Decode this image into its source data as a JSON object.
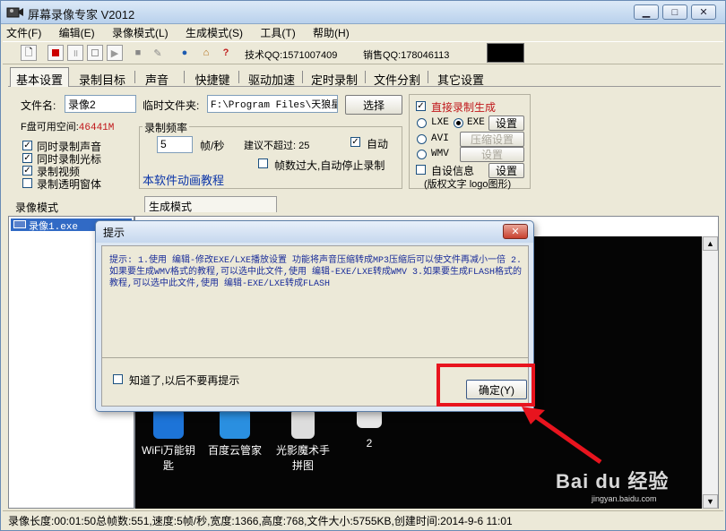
{
  "window": {
    "title": "屏幕录像专家 V2012"
  },
  "menu": [
    "文件(F)",
    "编辑(E)",
    "录像模式(L)",
    "生成模式(S)",
    "工具(T)",
    "帮助(H)"
  ],
  "toolbar": {
    "support_qq": "技术QQ:1571007409",
    "sales_qq": "销售QQ:178046113"
  },
  "tabs": [
    "基本设置",
    "录制目标",
    "声音",
    "快捷键",
    "驱动加速",
    "定时录制",
    "文件分割",
    "其它设置"
  ],
  "basic": {
    "filename_label": "文件名:",
    "filename_value": "录像2",
    "tempdir_label": "临时文件夹:",
    "tempdir_value": "F:\\Program Files\\天狼星",
    "select_button": "选择",
    "disk_label": "F盘可用空间:",
    "disk_value": "46441M",
    "options": [
      {
        "label": "同时录制声音",
        "checked": true
      },
      {
        "label": "同时录制光标",
        "checked": true
      },
      {
        "label": "录制视频",
        "checked": true
      },
      {
        "label": "录制透明窗体",
        "checked": false
      }
    ],
    "freq_group": "录制频率",
    "fps_value": "5",
    "fps_unit": "帧/秒",
    "suggest_label": "建议不超过:",
    "suggest_value": "25",
    "auto_label": "自动",
    "auto_stop_label": "帧数过大,自动停止录制",
    "tutorial_link": "本软件动画教程"
  },
  "generate": {
    "direct_label": "直接录制生成",
    "formats": [
      {
        "label": "LXE",
        "selected": false
      },
      {
        "label": "EXE",
        "selected": true
      },
      {
        "label": "AVI",
        "selected": false
      },
      {
        "label": "WMV",
        "selected": false
      }
    ],
    "settings_button": "设置",
    "compress_button": "压缩设置",
    "settings_button_2": "设置",
    "custom_info_label": "自设信息",
    "custom_info_button": "设置",
    "copyright_note": "(版权文字 logo图形)"
  },
  "panels": {
    "record_mode_tab": "录像模式",
    "generate_mode_tab": "生成模式",
    "list_item": "录像1.exe"
  },
  "desktop": {
    "icons": [
      {
        "label": "WiFi万能钥匙"
      },
      {
        "label": "百度云管家"
      },
      {
        "label": "光影魔术手拼图"
      },
      {
        "label": "2"
      }
    ]
  },
  "dialog": {
    "title": "提示",
    "message": "提示: 1.使用 编辑-修改EXE/LXE播放设置 功能将声音压缩转成MP3压缩后可以使文件再减小一倍 2.如果要生成WMV格式的教程,可以选中此文件,使用 编辑-EXE/LXE转成WMV 3.如果要生成FLASH格式的教程,可以选中此文件,使用 编辑-EXE/LXE转成FLASH",
    "dont_show_label": "知道了,以后不要再提示",
    "ok_button": "确定(Y)"
  },
  "statusbar": {
    "text": "录像长度:00:01:50总帧数:551,速度:5帧/秒,宽度:1366,高度:768,文件大小:5755KB,创建时间:2014-9-6 11:01"
  },
  "watermark": {
    "text": "Bai du 经验",
    "subtext": "jingyan.baidu.com"
  },
  "colors": {
    "accent_red": "#e8141e",
    "link_blue": "#0b35a8",
    "hint_blue": "#1a2d9a"
  }
}
